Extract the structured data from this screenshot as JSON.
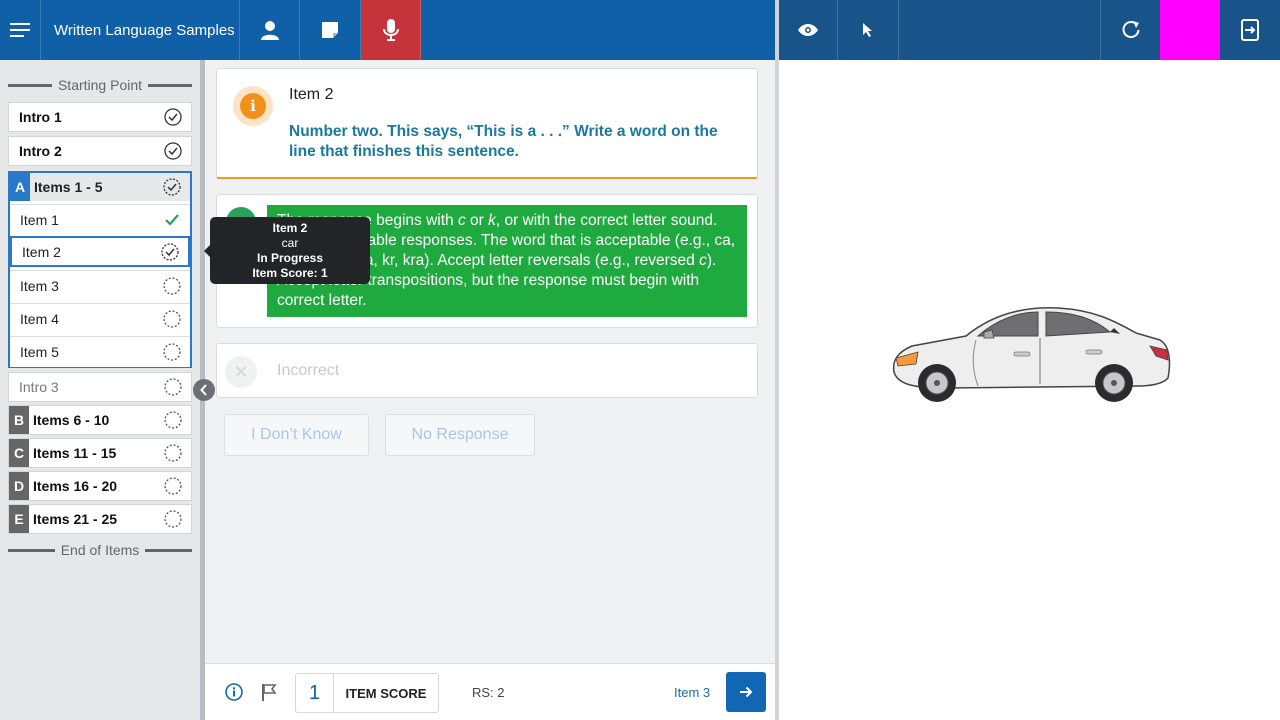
{
  "header": {
    "app_title": "Written Language Samples",
    "accent_color": "#1060a8",
    "mic_active_color": "#c4343a",
    "icons": [
      "menu-icon",
      "person-icon",
      "note-icon",
      "microphone-icon",
      "eye-icon",
      "pointer-icon",
      "refresh-icon",
      "exit-icon"
    ]
  },
  "sidebar": {
    "start_label": "Starting Point",
    "end_label": "End of Items",
    "intro1": "Intro 1",
    "intro2": "Intro 2",
    "groupA": {
      "letter": "A",
      "label": "Items 1 - 5"
    },
    "items": [
      "Item 1",
      "Item 2",
      "Item 3",
      "Item 4",
      "Item 5"
    ],
    "intro3": "Intro 3",
    "groupB": {
      "letter": "B",
      "label": "Items 6 - 10"
    },
    "groupC": {
      "letter": "C",
      "label": "Items 11 - 15"
    },
    "groupD": {
      "letter": "D",
      "label": "Items 16 - 20"
    },
    "groupE": {
      "letter": "E",
      "label": "Items 21 - 25"
    }
  },
  "item": {
    "title": "Item 2",
    "prompt": "Number two. This says, “This is a . . .” Write a word on the line that finishes this sentence."
  },
  "correct_text_html": "The response begins with <i>c</i> or <i>k</i>, or with the correct letter sound. Other reasonable responses. The word that is acceptable (e.g., ca, cr, cra, kar, ka, kr, kra). Accept letter reversals (e.g., reversed <i>c</i>). Accept letter transpositions, but the response must begin with correct letter.",
  "incorrect_label": "Incorrect",
  "buttons": {
    "dont_know": "I Don’t Know",
    "no_response": "No Response"
  },
  "tooltip": {
    "title": "Item 2",
    "response": "car",
    "status": "In Progress",
    "score": "Item Score: 1"
  },
  "footer": {
    "score_value": "1",
    "score_label": "ITEM SCORE",
    "rs": "RS: 2",
    "next_item": "Item 3"
  }
}
